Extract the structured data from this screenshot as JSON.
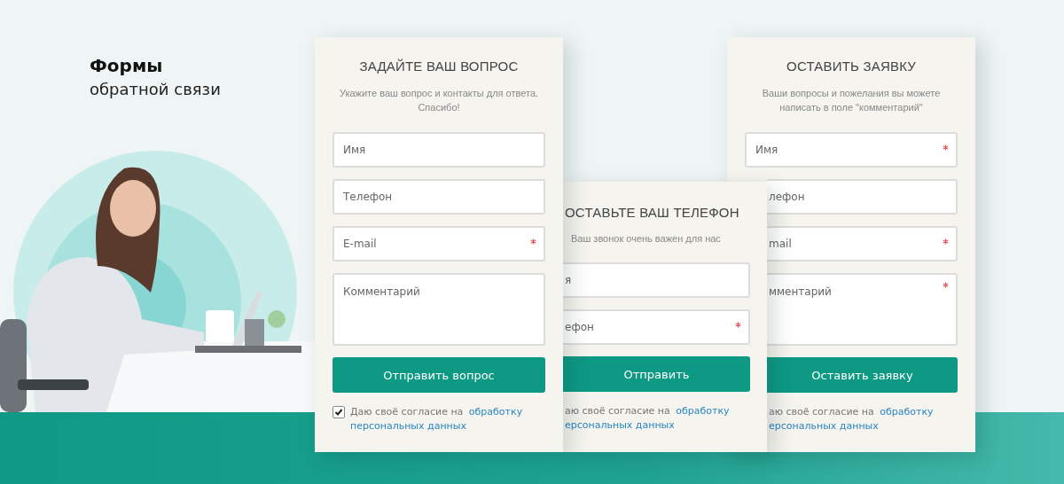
{
  "heading": {
    "title": "Формы",
    "subtitle": "обратной связи"
  },
  "forms": [
    {
      "title": "ЗАДАЙТЕ ВАШ ВОПРОС",
      "description": [
        "Укажите ваш вопрос и контакты для ответа.",
        "Спасибо!"
      ],
      "fields": [
        {
          "kind": "input",
          "placeholder": "Имя",
          "required": false,
          "partly_hidden": false
        },
        {
          "kind": "input",
          "placeholder": "Телефон",
          "required": false,
          "partly_hidden": false
        },
        {
          "kind": "input",
          "placeholder": "E-mail",
          "required": true,
          "partly_hidden": false
        },
        {
          "kind": "textarea",
          "placeholder": "Комментарий",
          "required": false,
          "partly_hidden": false
        }
      ],
      "button": {
        "label": "Отправить вопрос",
        "partly_hidden": false
      },
      "consent": {
        "checked": true,
        "partly_hidden": false,
        "text": "Даю своё согласие на",
        "link_lines": [
          "обработку",
          "персональных данных"
        ]
      }
    },
    {
      "title": "ОСТАВЬТЕ ВАШ ТЕЛЕФОН",
      "description": [
        "Ваш звонок очень важен для нас"
      ],
      "fields": [
        {
          "kind": "input",
          "placeholder": "я",
          "required": false,
          "partly_hidden": true
        },
        {
          "kind": "input",
          "placeholder": "ефон",
          "required": true,
          "partly_hidden": true
        }
      ],
      "button": {
        "label": "Отправить",
        "partly_hidden": true
      },
      "consent": {
        "partly_hidden": true,
        "text": "аю своё согласие на",
        "link_lines": [
          "обработку",
          "ерсональных данных"
        ]
      }
    },
    {
      "title": "ОСТАВИТЬ ЗАЯВКУ",
      "description": [
        "Ваши вопросы и пожелания вы можете",
        "написать в поле \"комментарий\""
      ],
      "fields": [
        {
          "kind": "input",
          "placeholder": "Имя",
          "required": true,
          "partly_hidden": false
        },
        {
          "kind": "input",
          "placeholder": "лефон",
          "required": false,
          "partly_hidden": true
        },
        {
          "kind": "input",
          "placeholder": "mail",
          "required": true,
          "partly_hidden": true
        },
        {
          "kind": "textarea",
          "placeholder": "мментарий",
          "required": true,
          "partly_hidden": true
        }
      ],
      "button": {
        "label": "Оставить заявку",
        "partly_hidden": true
      },
      "consent": {
        "partly_hidden": true,
        "text": "аю своё согласие на",
        "link_lines": [
          "обработку",
          "ерсональных данных"
        ]
      }
    }
  ]
}
